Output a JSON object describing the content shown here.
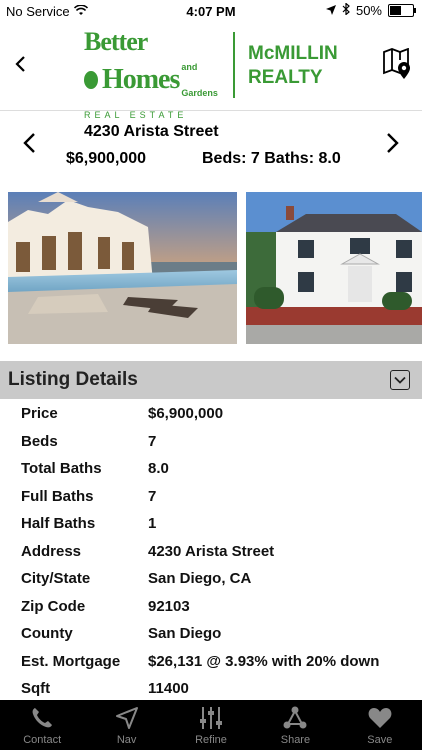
{
  "status_bar": {
    "carrier": "No Service",
    "time": "4:07 PM",
    "battery": "50%",
    "battery_level": 0.5
  },
  "header": {
    "brand_line1": "Better",
    "brand_line2": "Homes",
    "brand_line2_small": "and Gardens",
    "brand_sub": "REAL ESTATE",
    "company_line1": "McMILLIN",
    "company_line2": "REALTY"
  },
  "property": {
    "address": "4230 Arista Street",
    "price": "$6,900,000",
    "beds_baths": "Beds: 7  Baths: 8.0"
  },
  "details": {
    "title": "Listing Details",
    "rows": [
      {
        "label": "Price",
        "value": "$6,900,000"
      },
      {
        "label": "Beds",
        "value": "7"
      },
      {
        "label": "Total Baths",
        "value": "8.0"
      },
      {
        "label": "Full Baths",
        "value": "7"
      },
      {
        "label": "Half Baths",
        "value": "1"
      },
      {
        "label": "Address",
        "value": "4230 Arista Street"
      },
      {
        "label": "City/State",
        "value": "San Diego, CA"
      },
      {
        "label": "Zip Code",
        "value": "92103"
      },
      {
        "label": "County",
        "value": "San Diego"
      },
      {
        "label": "Est. Mortgage",
        "value": "$26,131 @ 3.93% with 20% down"
      },
      {
        "label": "Sqft",
        "value": "11400"
      }
    ]
  },
  "tabs": [
    {
      "label": "Contact",
      "icon": "phone-icon"
    },
    {
      "label": "Nav",
      "icon": "navigation-arrow-icon"
    },
    {
      "label": "Refine",
      "icon": "sliders-icon"
    },
    {
      "label": "Share",
      "icon": "share-icon"
    },
    {
      "label": "Save",
      "icon": "heart-icon"
    }
  ],
  "colors": {
    "brand_green": "#3a9a35",
    "section_header_bg": "#c9c9c9",
    "tab_bar_bg": "#000000",
    "tab_icon": "#888888"
  }
}
